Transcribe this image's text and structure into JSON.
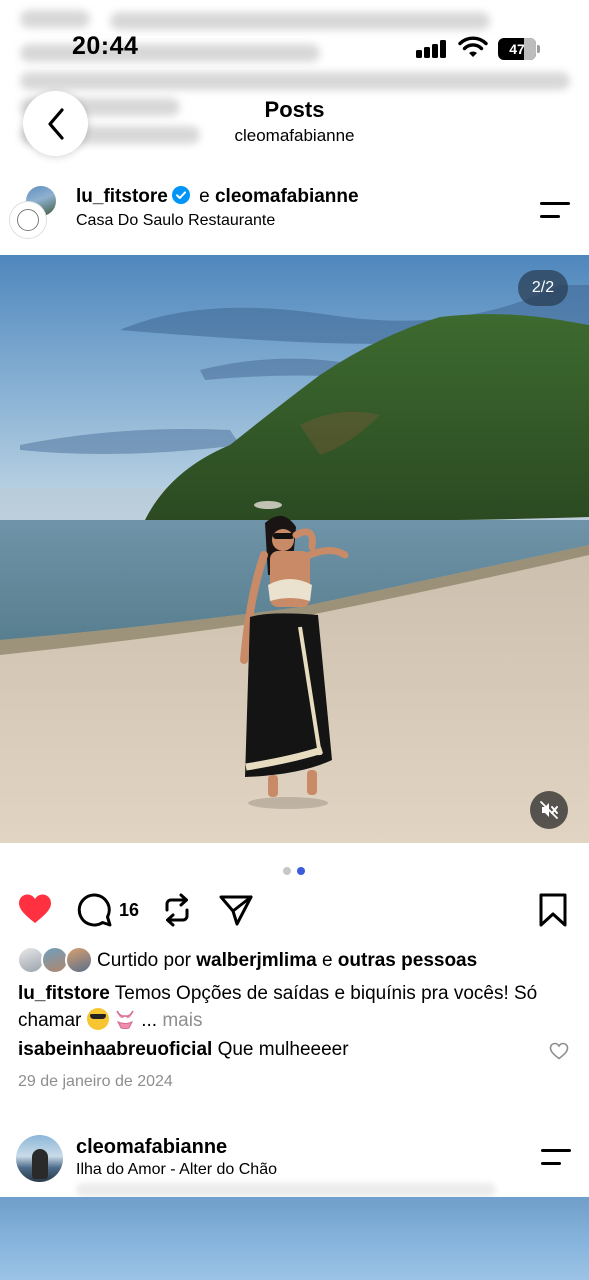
{
  "status_bar": {
    "time": "20:44",
    "battery": "47"
  },
  "nav": {
    "title": "Posts",
    "subtitle": "cleomafabianne"
  },
  "post": {
    "author_primary": "lu_fitstore",
    "author_joiner": " e ",
    "author_secondary": "cleomafabianne",
    "location": "Casa Do Saulo Restaurante",
    "page_indicator": "2/2",
    "carousel": {
      "total": 2,
      "active": 2
    },
    "comment_count": "16",
    "liked": true,
    "likes": {
      "prefix": "Curtido por ",
      "user": "walberjmlima",
      "joiner": " e ",
      "others": "outras pessoas"
    },
    "caption": {
      "user": "lu_fitstore",
      "text": " Temos Opções de saídas e biquínis pra vocês! Só chamar ",
      "ellipsis": "...",
      "more": "mais"
    },
    "top_comment": {
      "user": "isabeinhaabreuoficial",
      "text": " Que mulheeeer"
    },
    "date": "29 de janeiro de 2024"
  },
  "next_post": {
    "author": "cleomafabianne",
    "location": "Ilha do Amor - Alter do Chão"
  },
  "colors": {
    "like_red": "#ff3040",
    "dot_active": "#3b5bdb",
    "dot_inactive": "#c7c7c7",
    "verified_blue": "#0095f6",
    "secondary_text": "#8e8e8e"
  },
  "icons": {
    "back": "chevron-left-icon",
    "menu": "hamburger-menu-icon",
    "like": "heart-icon",
    "comment": "comment-bubble-icon",
    "repost": "repost-icon",
    "share": "paper-plane-icon",
    "save": "bookmark-icon",
    "mute": "speaker-muted-icon",
    "verified": "verified-badge-icon"
  }
}
